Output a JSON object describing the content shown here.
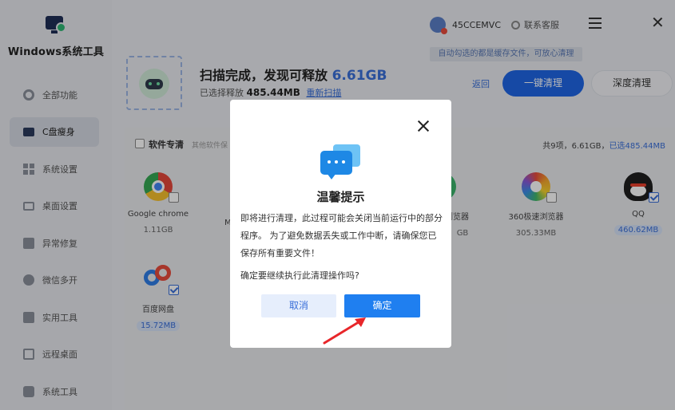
{
  "app": {
    "title": "Windows系统工具"
  },
  "sidebar": {
    "items": [
      {
        "label": "全部功能",
        "icon": "gear-icon"
      },
      {
        "label": "C盘瘦身",
        "icon": "drive-icon",
        "active": true
      },
      {
        "label": "系统设置",
        "icon": "grid-icon"
      },
      {
        "label": "桌面设置",
        "icon": "monitor-icon"
      },
      {
        "label": "异常修复",
        "icon": "wrench-icon"
      },
      {
        "label": "微信多开",
        "icon": "chat-icon"
      },
      {
        "label": "实用工具",
        "icon": "box-icon"
      },
      {
        "label": "远程桌面",
        "icon": "remote-icon"
      },
      {
        "label": "系统工具",
        "icon": "bag-icon"
      }
    ]
  },
  "topbar": {
    "user": "45CCEMVC",
    "support": "联系客服",
    "hint": "自动勾选的都是缓存文件，可放心清理"
  },
  "scan": {
    "title_prefix": "扫描完成，发现可释放",
    "total_size": "6.61GB",
    "selected_label": "已选择释放",
    "selected_size": "485.44MB",
    "rescan": "重新扫描",
    "back": "返回",
    "one_click": "一键清理",
    "deep": "深度清理"
  },
  "panel": {
    "title": "软件专清",
    "desc": "其他软件保",
    "total": "共9项，6.61GB，",
    "selected": "已选485.44MB",
    "apps": [
      {
        "name": "Google chrome",
        "size": "1.11GB",
        "checked": false
      },
      {
        "name": "M",
        "size": "",
        "checked": false
      },
      {
        "name": "浏览器",
        "size": "GB",
        "checked": false
      },
      {
        "name": "360极速浏览器",
        "size": "305.33MB",
        "checked": false
      },
      {
        "name": "QQ",
        "size": "460.62MB",
        "checked": true
      },
      {
        "name": "百度网盘",
        "size": "15.72MB",
        "checked": true
      }
    ]
  },
  "dialog": {
    "title": "温馨提示",
    "body": "即将进行清理，此过程可能会关闭当前运行中的部分程序。 为了避免数据丢失或工作中断，请确保您已保存所有重要文件！",
    "question": "确定要继续执行此清理操作吗?",
    "cancel": "取消",
    "ok": "确定"
  },
  "colors": {
    "accent": "#1f66e5",
    "dialog_ok": "#1f7ff0",
    "annotation_arrow": "#e8262a"
  }
}
